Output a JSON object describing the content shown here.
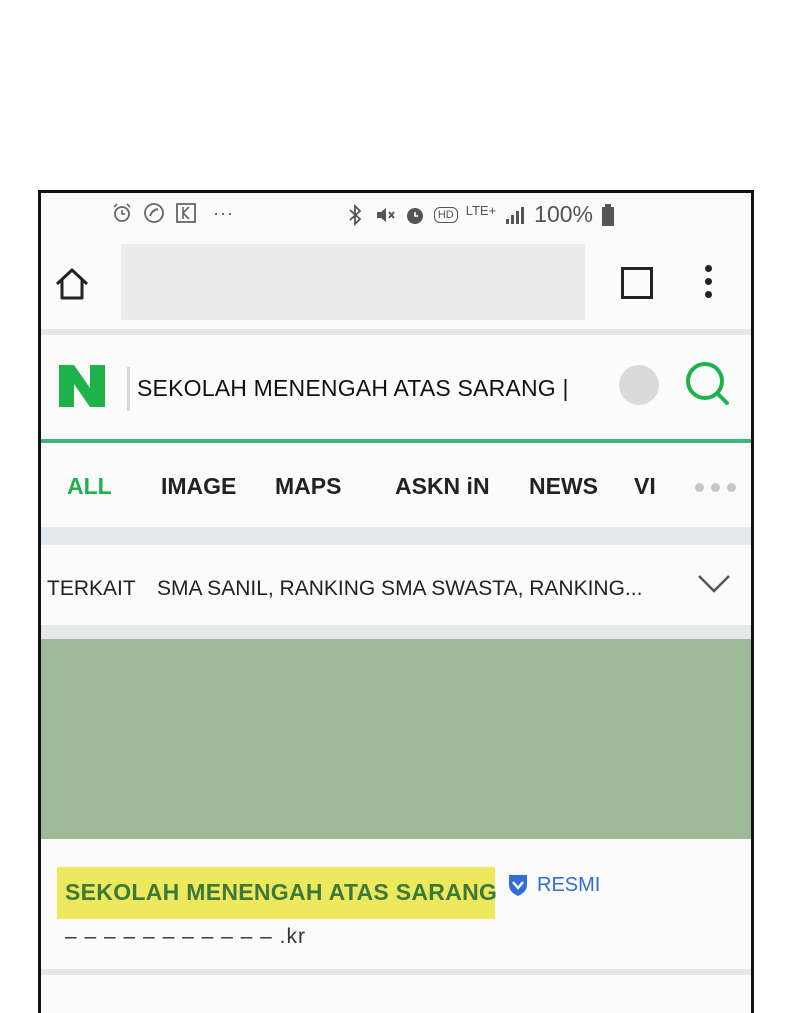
{
  "status_bar": {
    "left_icons": [
      "alarm-icon",
      "call-icon",
      "app-icon",
      "more-notifications-icon"
    ],
    "more_label": "···",
    "right_icons": [
      "bluetooth-icon",
      "mute-icon",
      "alarm-icon",
      "hd-icon",
      "lte-icon",
      "signal-icon"
    ],
    "hd_label": "HD",
    "lte_label": "LTE+",
    "battery_text": "100%"
  },
  "browser": {
    "home_icon": "home-icon",
    "tabs_icon": "tabs-icon",
    "menu_icon": "more-vert-icon"
  },
  "search": {
    "logo_letter": "N",
    "query": "SEKOLAH MENENGAH ATAS SARANG |",
    "search_icon": "search-icon",
    "accent_color": "#1fb24b"
  },
  "nav_tabs": [
    {
      "label": "ALL",
      "active": true
    },
    {
      "label": "IMAGE",
      "active": false
    },
    {
      "label": "MAPS",
      "active": false
    },
    {
      "label": "ASKN iN",
      "active": false
    },
    {
      "label": "NEWS",
      "active": false
    },
    {
      "label": "VI",
      "active": false
    }
  ],
  "related": {
    "label": "TERKAIT",
    "items": "SMA SANIL, RANKING SMA SWASTA, RANKING..."
  },
  "result": {
    "title": "SEKOLAH MENENGAH ATAS SARANG",
    "badge": "RESMI",
    "url": "– – – – – – – – – – – .kr",
    "highlight_color": "#ede85e",
    "title_color": "#3c7a3a"
  }
}
